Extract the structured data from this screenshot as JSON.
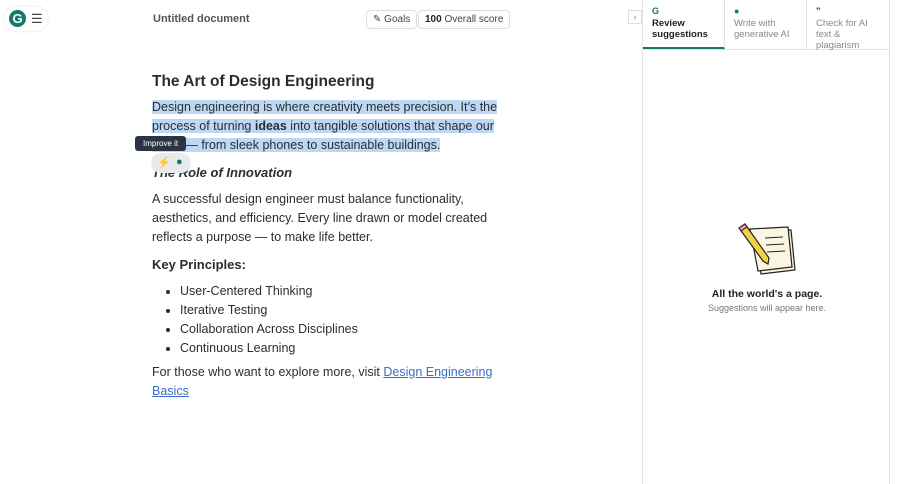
{
  "header": {
    "logo": "G",
    "doc_title": "Untitled document",
    "goals_label": "Goals",
    "score_value": "100",
    "score_label": "Overall score"
  },
  "doc": {
    "title": "The Art of Design Engineering",
    "intro_a": "Design engineering is where creativity meets precision. It’s the process of turning ",
    "intro_bold": "ideas",
    "intro_b": " into tangible solutions that shape our world — from sleek phones to sustainable buildings.",
    "h_innovation": "The Role of Innovation",
    "p_innovation": "A successful design engineer must balance functionality, aesthetics, and efficiency. Every line drawn or model created reflects a purpose — to make life better.",
    "h_principles": "Key Principles:",
    "principles": [
      "User-Centered Thinking",
      "Iterative Testing",
      "Collaboration Across Disciplines",
      "Continuous Learning"
    ],
    "outro": "For those who want to explore more, visit ",
    "link": "Design Engineering Basics"
  },
  "tooltip": "Improve it",
  "panel": {
    "tabs": [
      {
        "label": "Review suggestions",
        "icon": "grammarly-icon"
      },
      {
        "label": "Write with generative AI",
        "icon": "lightbulb-icon"
      },
      {
        "label": "Check for AI text & plagiarism",
        "icon": "quote-icon"
      }
    ],
    "empty_title": "All the world's a page.",
    "empty_sub": "Suggestions will appear here."
  },
  "colors": {
    "accent": "#15786a",
    "selection": "#bcd8f5",
    "link": "#3b6fc5"
  }
}
